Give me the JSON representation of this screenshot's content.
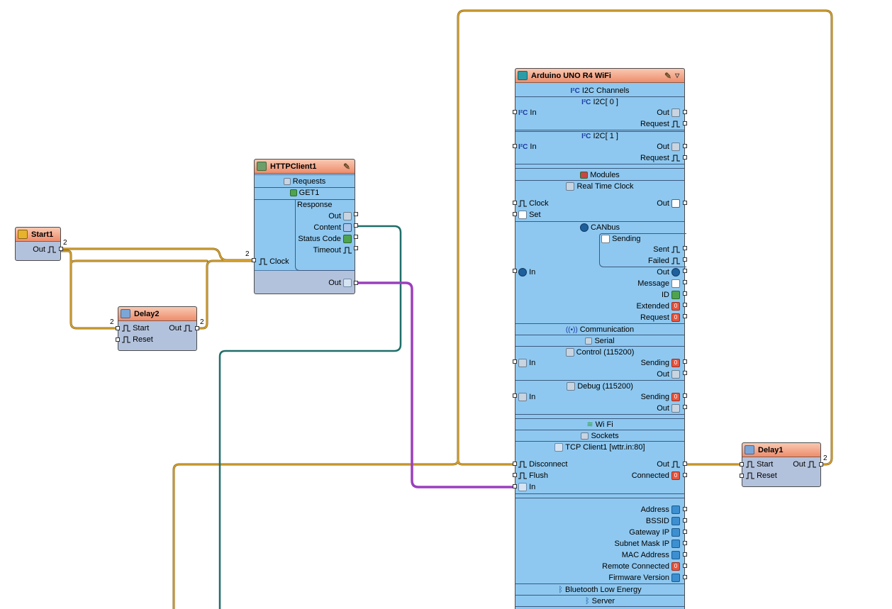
{
  "start1": {
    "title": "Start1",
    "out": "Out",
    "count": "2"
  },
  "delay2": {
    "title": "Delay2",
    "start": "Start",
    "reset": "Reset",
    "out": "Out",
    "count_in": "2",
    "count_out": "2"
  },
  "http": {
    "title": "HTTPClient1",
    "requests": "Requests",
    "get": "GET1",
    "response": "Response",
    "out": "Out",
    "content": "Content",
    "status": "Status Code",
    "timeout": "Timeout",
    "clock": "Clock",
    "clock_count": "2",
    "main_out": "Out"
  },
  "arduino": {
    "title": "Arduino UNO R4 WiFi",
    "i2c_channels": "I2C Channels",
    "i2c0": "I2C[ 0 ]",
    "i2c1": "I2C[ 1 ]",
    "in": "In",
    "out": "Out",
    "request": "Request",
    "modules": "Modules",
    "rtc": "Real Time Clock",
    "clock": "Clock",
    "set": "Set",
    "canbus": "CANbus",
    "sending": "Sending",
    "sent": "Sent",
    "failed": "Failed",
    "message": "Message",
    "id": "ID",
    "extended": "Extended",
    "communication": "Communication",
    "serial": "Serial",
    "control": "Control (115200)",
    "debug": "Debug (115200)",
    "wifi": "Wi Fi",
    "sockets": "Sockets",
    "tcp": "TCP Client1 [wttr.in:80]",
    "disconnect": "Disconnect",
    "flush": "Flush",
    "connected": "Connected",
    "address": "Address",
    "bssid": "BSSID",
    "gateway": "Gateway IP",
    "subnet": "Subnet Mask IP",
    "mac": "MAC Address",
    "remote": "Remote Connected",
    "firmware": "Firmware Version",
    "ble": "Bluetooth Low Energy",
    "server": "Server"
  },
  "delay1": {
    "title": "Delay1",
    "start": "Start",
    "reset": "Reset",
    "out": "Out",
    "count": "2"
  },
  "colors": {
    "wire_clock": "#c8961e",
    "wire_text": "#1f6e6a",
    "wire_object": "#9b3fbe",
    "header": "#ee8d6c",
    "body": "#b3c2dc",
    "pin_area": "#8ec8f0"
  }
}
